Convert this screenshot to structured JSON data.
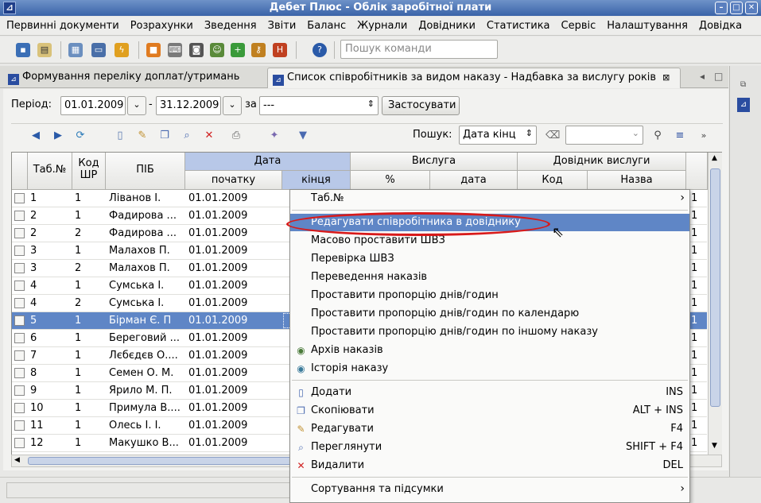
{
  "window": {
    "title": "Дебет Плюс - Облік заробітної плати"
  },
  "menu": [
    "Первинні документи",
    "Розрахунки",
    "Зведення",
    "Звіти",
    "Баланс",
    "Журнали",
    "Довідники",
    "Статистика",
    "Сервіс",
    "Налаштування",
    "Довідка"
  ],
  "toolbar": {
    "search_placeholder": "Пошук команди"
  },
  "tabs": [
    {
      "label": "Формування переліку доплат/утримань"
    },
    {
      "label": "Список співробітників за видом наказу - Надбавка за вислугу років"
    }
  ],
  "filter": {
    "period_label": "Період:",
    "date_from": "01.01.2009",
    "dash": "-",
    "date_to": "31.12.2009",
    "by_label": "за",
    "by_value": "---",
    "apply_label": "Застосувати"
  },
  "grid_toolbar": {
    "search_label": "Пошук:",
    "search_field": "Дата кінц",
    "search_value": ""
  },
  "grid": {
    "headers": {
      "tab_no": "Таб.№",
      "kod_shr": "Код ШР",
      "pib": "ПІБ",
      "data_group": "Дата",
      "start": "початку",
      "end": "кінця",
      "vysluha_group": "Вислуга",
      "percent": "%",
      "date": "дата",
      "dovidnyk_group": "Довідник вислуги",
      "kod": "Код",
      "nazva": "Назва"
    },
    "rows": [
      {
        "tab": "1",
        "kod": "1",
        "pib": "Ліванов І.",
        "start": "01.01.2009",
        "tail": "1"
      },
      {
        "tab": "2",
        "kod": "1",
        "pib": "Фадирова ...",
        "start": "01.01.2009",
        "tail": "1"
      },
      {
        "tab": "2",
        "kod": "2",
        "pib": "Фадирова ...",
        "start": "01.01.2009",
        "tail": "1"
      },
      {
        "tab": "3",
        "kod": "1",
        "pib": "Малахов П.",
        "start": "01.01.2009",
        "tail": "1"
      },
      {
        "tab": "3",
        "kod": "2",
        "pib": "Малахов П.",
        "start": "01.01.2009",
        "tail": "1"
      },
      {
        "tab": "4",
        "kod": "1",
        "pib": "Сумська І.",
        "start": "01.01.2009",
        "tail": "1"
      },
      {
        "tab": "4",
        "kod": "2",
        "pib": "Сумська І.",
        "start": "01.01.2009",
        "tail": "1"
      },
      {
        "tab": "5",
        "kod": "1",
        "pib": "Бірман Є. П",
        "start": "01.01.2009",
        "tail": "1"
      },
      {
        "tab": "6",
        "kod": "1",
        "pib": "Береговий ...",
        "start": "01.01.2009",
        "tail": "1"
      },
      {
        "tab": "7",
        "kod": "1",
        "pib": "Лєбєдєв О....",
        "start": "01.01.2009",
        "tail": "1"
      },
      {
        "tab": "8",
        "kod": "1",
        "pib": "Семен О. М.",
        "start": "01.01.2009",
        "tail": "1"
      },
      {
        "tab": "9",
        "kod": "1",
        "pib": "Ярило М. П.",
        "start": "01.01.2009",
        "tail": "1"
      },
      {
        "tab": "10",
        "kod": "1",
        "pib": "Примула В....",
        "start": "01.01.2009",
        "tail": "1"
      },
      {
        "tab": "11",
        "kod": "1",
        "pib": "Олесь І. І.",
        "start": "01.01.2009",
        "tail": "1"
      },
      {
        "tab": "12",
        "kod": "1",
        "pib": "Макушко В...",
        "start": "01.01.2009",
        "tail": "1"
      }
    ]
  },
  "context_menu": {
    "items": [
      {
        "label": "Таб.№",
        "shortcut": "",
        "submenu": true,
        "icon": ""
      },
      {
        "label": "Редагувати співробітника в довіднику",
        "shortcut": "",
        "submenu": false,
        "icon": "",
        "highlight": true
      },
      {
        "label": "Масово проставити ШВЗ",
        "shortcut": "",
        "submenu": false,
        "icon": ""
      },
      {
        "label": "Перевірка ШВЗ",
        "shortcut": "",
        "submenu": false,
        "icon": ""
      },
      {
        "label": "Переведення наказів",
        "shortcut": "",
        "submenu": false,
        "icon": ""
      },
      {
        "label": "Проставити пропорцію днів/годин",
        "shortcut": "",
        "submenu": false,
        "icon": ""
      },
      {
        "label": "Проставити пропорцію днів/годин по календарю",
        "shortcut": "",
        "submenu": false,
        "icon": ""
      },
      {
        "label": "Проставити пропорцію днів/годин по іншому наказу",
        "shortcut": "",
        "submenu": false,
        "icon": ""
      },
      {
        "label": "Архів наказів",
        "shortcut": "",
        "submenu": false,
        "icon": "archive-icon"
      },
      {
        "label": "Історія наказу",
        "shortcut": "",
        "submenu": false,
        "icon": "history-icon"
      },
      {
        "label": "Додати",
        "shortcut": "INS",
        "submenu": false,
        "icon": "add-icon"
      },
      {
        "label": "Скопіювати",
        "shortcut": "ALT + INS",
        "submenu": false,
        "icon": "copy-icon"
      },
      {
        "label": "Редагувати",
        "shortcut": "F4",
        "submenu": false,
        "icon": "edit-icon"
      },
      {
        "label": "Переглянути",
        "shortcut": "SHIFT + F4",
        "submenu": false,
        "icon": "view-icon"
      },
      {
        "label": "Видалити",
        "shortcut": "DEL",
        "submenu": false,
        "icon": "delete-icon"
      },
      {
        "label": "Сортування та підсумки",
        "shortcut": "",
        "submenu": true,
        "icon": ""
      }
    ]
  },
  "colors": {
    "selection": "#5f86c6",
    "annotation": "#d81a1a",
    "titlebar": "#3a63a8"
  }
}
